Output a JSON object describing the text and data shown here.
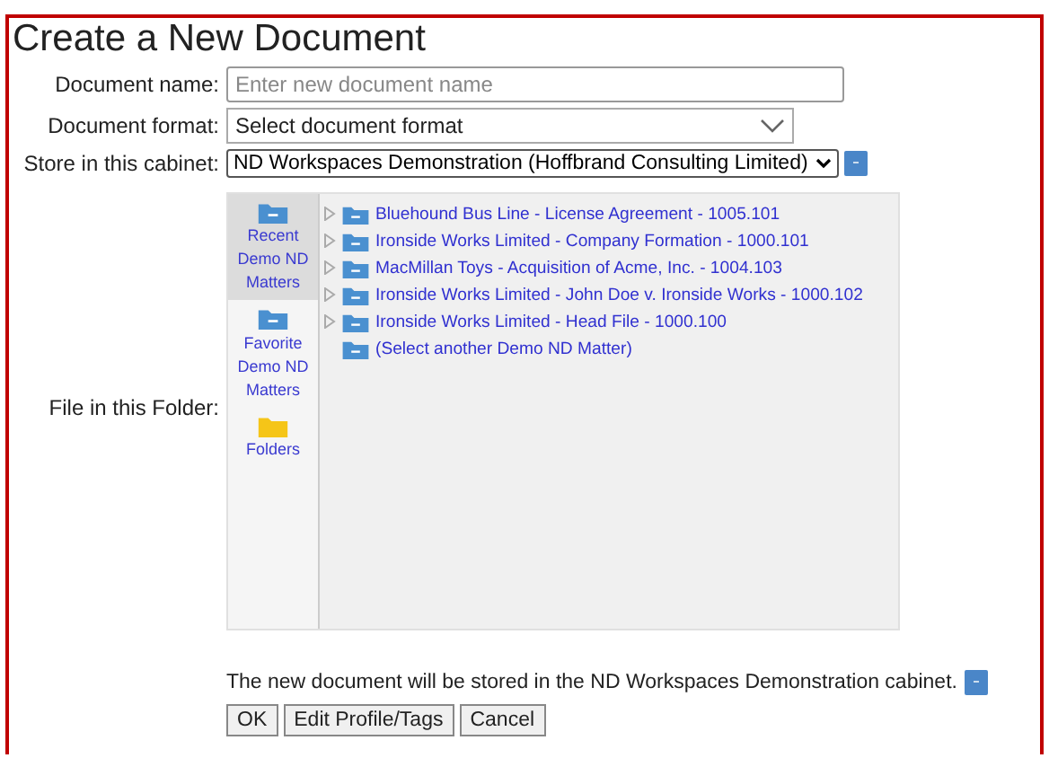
{
  "title": "Create a New Document",
  "fields": [
    {
      "label": "Document name:",
      "kind": "text",
      "placeholder": "Enter new document name"
    },
    {
      "label": "Document format:",
      "kind": "dropdown",
      "value": "Select document format"
    },
    {
      "label": "Store in this cabinet:",
      "kind": "select",
      "value": "ND Workspaces Demonstration (Hoffbrand Consulting Limited)"
    }
  ],
  "folder_label": "File in this Folder:",
  "nav": [
    {
      "label": "Recent Demo ND Matters",
      "kind": "recent",
      "selected": true
    },
    {
      "label": "Favorite Demo ND Matters",
      "kind": "favorite",
      "selected": false
    },
    {
      "label": "Folders",
      "kind": "folders",
      "selected": false
    }
  ],
  "tree": [
    {
      "label": "Bluehound Bus Line - License Agreement - 1005.101",
      "expandable": true
    },
    {
      "label": "Ironside Works Limited - Company Formation - 1000.101",
      "expandable": true
    },
    {
      "label": "MacMillan Toys - Acquisition of Acme, Inc. - 1004.103",
      "expandable": true
    },
    {
      "label": "Ironside Works Limited - John Doe v. Ironside Works - 1000.102",
      "expandable": true
    },
    {
      "label": "Ironside Works Limited - Head File - 1000.100",
      "expandable": true
    },
    {
      "label": "(Select another Demo ND Matter)",
      "expandable": false
    }
  ],
  "message": "The new document will be stored in the ND Workspaces Demonstration cabinet.",
  "buttons": [
    "OK",
    "Edit Profile/Tags",
    "Cancel"
  ]
}
